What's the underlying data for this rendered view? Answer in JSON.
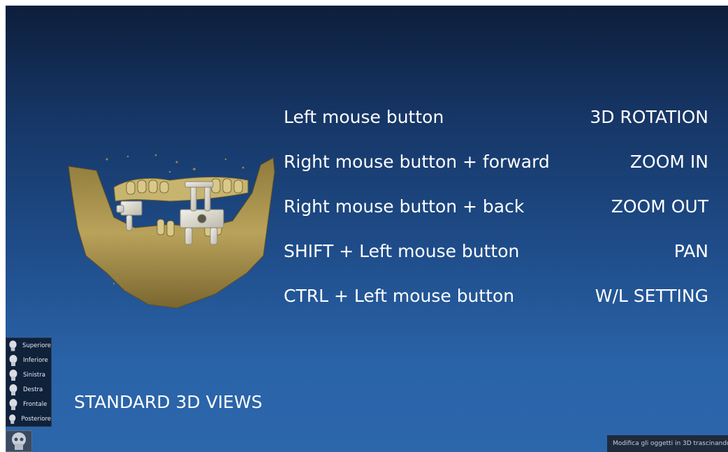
{
  "mouse_help": {
    "rows": [
      {
        "action": "Left mouse button",
        "result": "3D ROTATION"
      },
      {
        "action": "Right mouse button + forward",
        "result": "ZOOM IN"
      },
      {
        "action": "Right mouse button + back",
        "result": "ZOOM OUT"
      },
      {
        "action": "SHIFT + Left mouse button",
        "result": "PAN"
      },
      {
        "action": "CTRL + Left mouse button",
        "result": "W/L SETTING"
      }
    ]
  },
  "standard_views_label": "STANDARD 3D VIEWS",
  "views_panel": {
    "items": [
      {
        "label": "Superiore",
        "icon": "head-top-icon"
      },
      {
        "label": "Inferiore",
        "icon": "head-bottom-icon"
      },
      {
        "label": "Sinistra",
        "icon": "head-left-icon"
      },
      {
        "label": "Destra",
        "icon": "head-right-icon"
      },
      {
        "label": "Frontale",
        "icon": "head-front-icon"
      },
      {
        "label": "Posteriore",
        "icon": "head-back-icon"
      }
    ]
  },
  "status_bar": {
    "text": "Modifica gli oggetti in 3D trascinandoli"
  },
  "colors": {
    "background_top": "#0d1e3b",
    "background_bottom": "#2c66ab",
    "bone": "#b9a25a",
    "implant": "#e6e4dc",
    "text": "#ffffff"
  }
}
